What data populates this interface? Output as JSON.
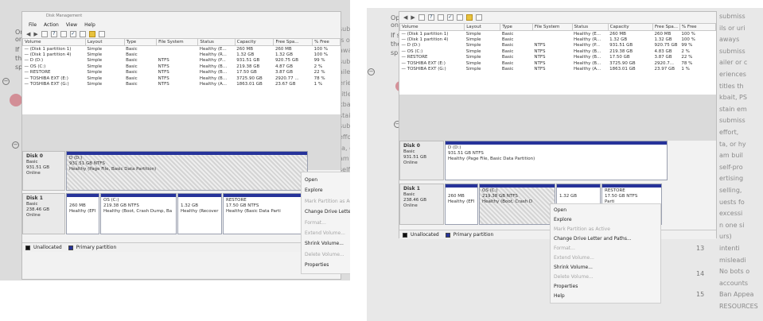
{
  "menu": [
    "File",
    "Action",
    "View",
    "Help"
  ],
  "columns": [
    "Volume",
    "Layout",
    "Type",
    "File System",
    "Status",
    "Capacity",
    "Free Spa...",
    "% Free"
  ],
  "left": {
    "title_fragment": "Disk Management",
    "rows": [
      [
        "(Disk 1 partition 1)",
        "Simple",
        "Basic",
        "",
        "Healthy (E...",
        "260 MB",
        "260 MB",
        "100 %"
      ],
      [
        "(Disk 1 partition 4)",
        "Simple",
        "Basic",
        "",
        "Healthy (R...",
        "1.32 GB",
        "1.32 GB",
        "100 %"
      ],
      [
        "D (D:)",
        "Simple",
        "Basic",
        "NTFS",
        "Healthy (P...",
        "931.51 GB",
        "920.75 GB",
        "99 %"
      ],
      [
        "OS (C:)",
        "Simple",
        "Basic",
        "NTFS",
        "Healthy (B...",
        "219.38 GB",
        "4.87 GB",
        "2 %"
      ],
      [
        "RESTORE",
        "Simple",
        "Basic",
        "NTFS",
        "Healthy (B...",
        "17.50 GB",
        "3.87 GB",
        "22 %"
      ],
      [
        "TOSHIBA EXT (E:)",
        "Simple",
        "Basic",
        "NTFS",
        "Healthy (B...",
        "3725.90 GB",
        "2920.77 ...",
        "78 %"
      ],
      [
        "TOSHIBA EXT (G:)",
        "Simple",
        "Basic",
        "NTFS",
        "Healthy (A...",
        "1863.01 GB",
        "23.67 GB",
        "1 %"
      ]
    ],
    "disk0": {
      "label": "Disk 0",
      "kind": "Basic",
      "size": "931.51 GB",
      "state": "Online",
      "part": {
        "name": "D (D:)",
        "size": "931.51 GB NTFS",
        "status": "Healthy (Page File, Basic Data Partition)"
      }
    },
    "disk1": {
      "label": "Disk 1",
      "kind": "Basic",
      "size": "238.46 GB",
      "state": "Online",
      "parts": [
        {
          "name": "",
          "size": "260 MB",
          "status": "Healthy (EFI"
        },
        {
          "name": "OS (C:)",
          "size": "219.38 GB NTFS",
          "status": "Healthy (Boot, Crash Dump, Ba"
        },
        {
          "name": "",
          "size": "1.32 GB",
          "status": "Healthy (Recover"
        },
        {
          "name": "RESTORE",
          "size": "17.50 GB NTFS",
          "status": "Healthy (Basic Data Parti"
        }
      ]
    },
    "legend": [
      "Unallocated",
      "Primary partition"
    ],
    "context_menu": [
      {
        "label": "Open",
        "enabled": true
      },
      {
        "label": "Explore",
        "enabled": true
      },
      {
        "label": "Mark Partition as Active",
        "enabled": false
      },
      {
        "label": "Change Drive Letter and Paths...",
        "enabled": true
      },
      {
        "label": "Format...",
        "enabled": false
      },
      {
        "label": "Extend Volume...",
        "enabled": false
      },
      {
        "label": "Shrink Volume...",
        "enabled": true
      },
      {
        "label": "Delete Volume...",
        "enabled": false
      },
      {
        "label": "Properties",
        "enabled": true
      }
    ],
    "background_text": [
      "submission",
      "ls or unauth",
      "aways",
      "submission",
      "ailer or cust",
      "eriences",
      "titles that a",
      "kbait, PSAs",
      "stain emoji",
      "submission",
      "effort, me",
      "ta, or hypo",
      "am builds.",
      "self-prom"
    ],
    "left_fragments": [
      "Or",
      "on",
      "If s",
      "the",
      "sp"
    ]
  },
  "right": {
    "rows": [
      [
        "(Disk 1 partition 1)",
        "Simple",
        "Basic",
        "",
        "Healthy (E...",
        "260 MB",
        "260 MB",
        "100 %"
      ],
      [
        "(Disk 1 partition 4)",
        "Simple",
        "Basic",
        "",
        "Healthy (R...",
        "1.32 GB",
        "1.32 GB",
        "100 %"
      ],
      [
        "D (D:)",
        "Simple",
        "Basic",
        "NTFS",
        "Healthy (P...",
        "931.51 GB",
        "920.75 GB",
        "99 %"
      ],
      [
        "OS (C:)",
        "Simple",
        "Basic",
        "NTFS",
        "Healthy (B...",
        "219.38 GB",
        "4.83 GB",
        "2 %"
      ],
      [
        "RESTORE",
        "Simple",
        "Basic",
        "NTFS",
        "Healthy (B...",
        "17.50 GB",
        "3.87 GB",
        "22 %"
      ],
      [
        "TOSHIBA EXT (E:)",
        "Simple",
        "Basic",
        "NTFS",
        "Healthy (B...",
        "3725.90 GB",
        "2920.7...",
        "78 %"
      ],
      [
        "TOSHIBA EXT (G:)",
        "Simple",
        "Basic",
        "NTFS",
        "Healthy (A...",
        "1863.01 GB",
        "23.97 GB",
        "1 %"
      ]
    ],
    "disk0": {
      "label": "Disk 0",
      "kind": "Basic",
      "size": "931.51 GB",
      "state": "Online",
      "part": {
        "name": "D (D:)",
        "size": "931.51 GB NTFS",
        "status": "Healthy (Page File, Basic Data Partition)"
      }
    },
    "disk1": {
      "label": "Disk 1",
      "kind": "Basic",
      "size": "238.46 GB",
      "state": "Online",
      "parts": [
        {
          "name": "",
          "size": "260 MB",
          "status": "Healthy (EFI"
        },
        {
          "name": "OS (C:)",
          "size": "219.38 GB NTFS",
          "status": "Healthy (Boot, Crash D"
        },
        {
          "name": "",
          "size": "1.32 GB",
          "status": ""
        },
        {
          "name": "RESTORE",
          "size": "17.50 GB NTFS",
          "status": "Parti"
        }
      ]
    },
    "legend": [
      "Unallocated",
      "Primary partition"
    ],
    "context_menu": [
      {
        "label": "Open",
        "enabled": true
      },
      {
        "label": "Explore",
        "enabled": true
      },
      {
        "label": "Mark Partition as Active",
        "enabled": false
      },
      {
        "label": "Change Drive Letter and Paths...",
        "enabled": true
      },
      {
        "label": "Format...",
        "enabled": false
      },
      {
        "label": "Extend Volume...",
        "enabled": false
      },
      {
        "label": "Shrink Volume...",
        "enabled": true
      },
      {
        "label": "Delete Volume...",
        "enabled": false
      },
      {
        "label": "Properties",
        "enabled": true
      },
      {
        "label": "Help",
        "enabled": true
      }
    ],
    "background_text": [
      "submiss",
      "ils or uri",
      "aways",
      "submiss",
      "ailer or c",
      "eriences",
      "titles th",
      "kbait, PS",
      "stain em",
      "submiss",
      "effort,",
      "ta, or hy",
      "am buil",
      "self-pro",
      "ertising",
      "selling,",
      "uests fo",
      "excessi",
      "n one si",
      "urs)",
      "intenti",
      "misleadi",
      "No bots o",
      "accounts",
      "Ban Appea",
      "RESOURCES"
    ],
    "left_fragments": [
      "Op",
      "on",
      "If s",
      "the",
      "sp"
    ],
    "list_numbers": [
      "13",
      "14",
      "15"
    ]
  }
}
